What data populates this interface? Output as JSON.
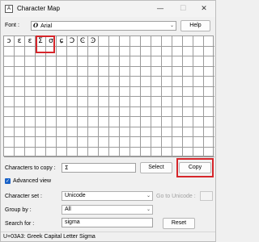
{
  "window": {
    "title": "Character Map",
    "app_icon_glyph": "A",
    "minimize_glyph": "—",
    "maximize_glyph": "☐",
    "close_glyph": "✕"
  },
  "font_row": {
    "label": "Font :",
    "value": "Arial",
    "value_glyph": "O",
    "dropdown_glyph": "⌄",
    "help_label": "Help"
  },
  "grid": {
    "rows": 12,
    "columns": 20,
    "visible_characters": [
      "ɔ",
      "ɛ",
      "ɛ",
      "Σ",
      "σ",
      "ɕ",
      "Ͻ",
      "Ͼ",
      "Ͽ"
    ],
    "selected_character": "Σ"
  },
  "chars_row": {
    "label": "Characters to copy :",
    "value": "Σ",
    "select_label": "Select",
    "copy_label": "Copy"
  },
  "advanced": {
    "label": "Advanced view",
    "checked": true,
    "check_glyph": "✓"
  },
  "character_set": {
    "label": "Character set :",
    "value": "Unicode",
    "goto_label": "Go to Unicode :"
  },
  "group_by": {
    "label": "Group by :",
    "value": "All"
  },
  "search": {
    "label": "Search for :",
    "value": "sigma",
    "reset_label": "Reset"
  },
  "status": {
    "text": "U+03A3: Greek Capital Letter Sigma"
  },
  "colors": {
    "highlight": "#d6262b",
    "checkbox": "#1a62c7"
  }
}
